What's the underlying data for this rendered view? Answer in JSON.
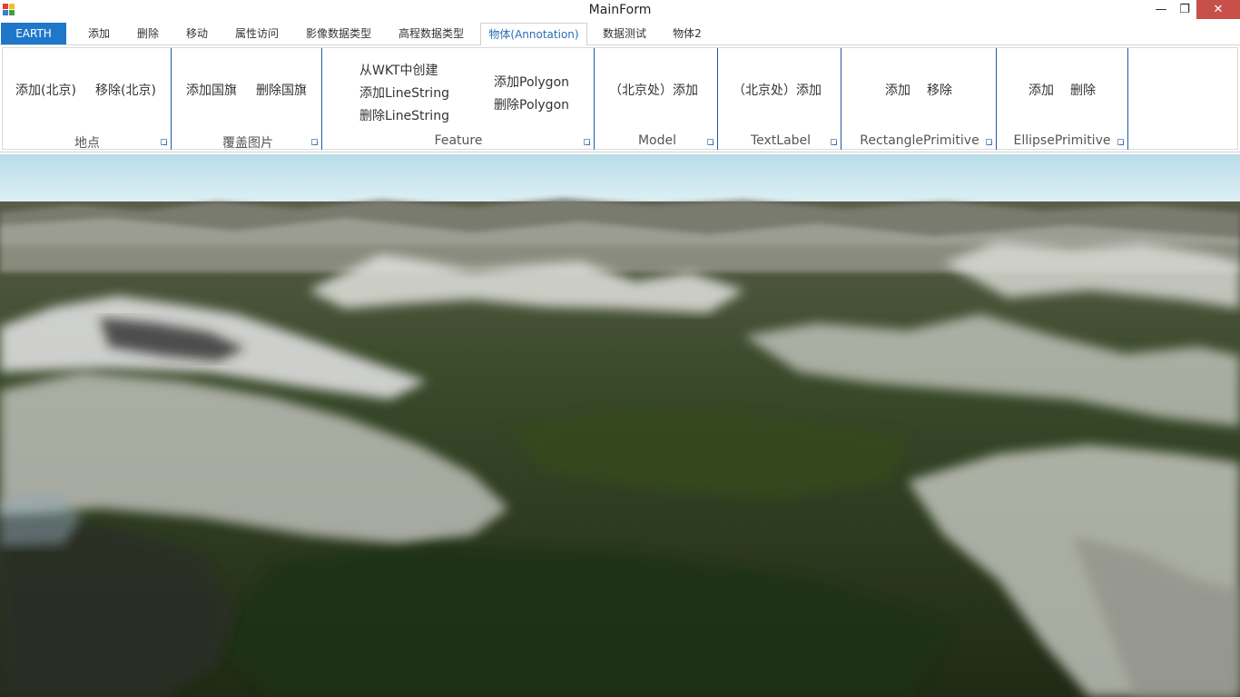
{
  "window": {
    "title": "MainForm",
    "minimize": "—",
    "maximize": "❐",
    "close": "✕"
  },
  "tabs": [
    {
      "label": "EARTH"
    },
    {
      "label": "添加"
    },
    {
      "label": "删除"
    },
    {
      "label": "移动"
    },
    {
      "label": "属性访问"
    },
    {
      "label": "影像数据类型"
    },
    {
      "label": "高程数据类型"
    },
    {
      "label": "物体(Annotation)"
    },
    {
      "label": "数据测试"
    },
    {
      "label": "物体2"
    }
  ],
  "ribbon": {
    "groups": [
      {
        "label": "地点",
        "buttons": [
          "添加(北京)",
          "移除(北京)"
        ]
      },
      {
        "label": "覆盖图片",
        "buttons": [
          "添加国旗",
          "删除国旗"
        ]
      },
      {
        "label": "Feature",
        "buttons": [
          "从WKT中创建",
          "添加LineString",
          "删除LineString",
          "添加Polygon",
          "删除Polygon"
        ]
      },
      {
        "label": "Model",
        "buttons": [
          "（北京处）添加"
        ]
      },
      {
        "label": "TextLabel",
        "buttons": [
          "（北京处）添加"
        ]
      },
      {
        "label": "RectanglePrimitive",
        "buttons": [
          "添加",
          "移除"
        ]
      },
      {
        "label": "EllipsePrimitive",
        "buttons": [
          "添加",
          "删除"
        ]
      }
    ]
  },
  "colors": {
    "file_tab": "#1f77c9",
    "active_tab_text": "#2a6fb5",
    "group_separator": "#1f5aa6",
    "close_button": "#c7504a",
    "sky": "#cfe6f0",
    "terrain_dark": "#2c3a20",
    "terrain_snow": "#e6e6e6"
  },
  "icons": {
    "app": "app-icon",
    "dialog_launcher": "dialog-launcher-icon"
  }
}
